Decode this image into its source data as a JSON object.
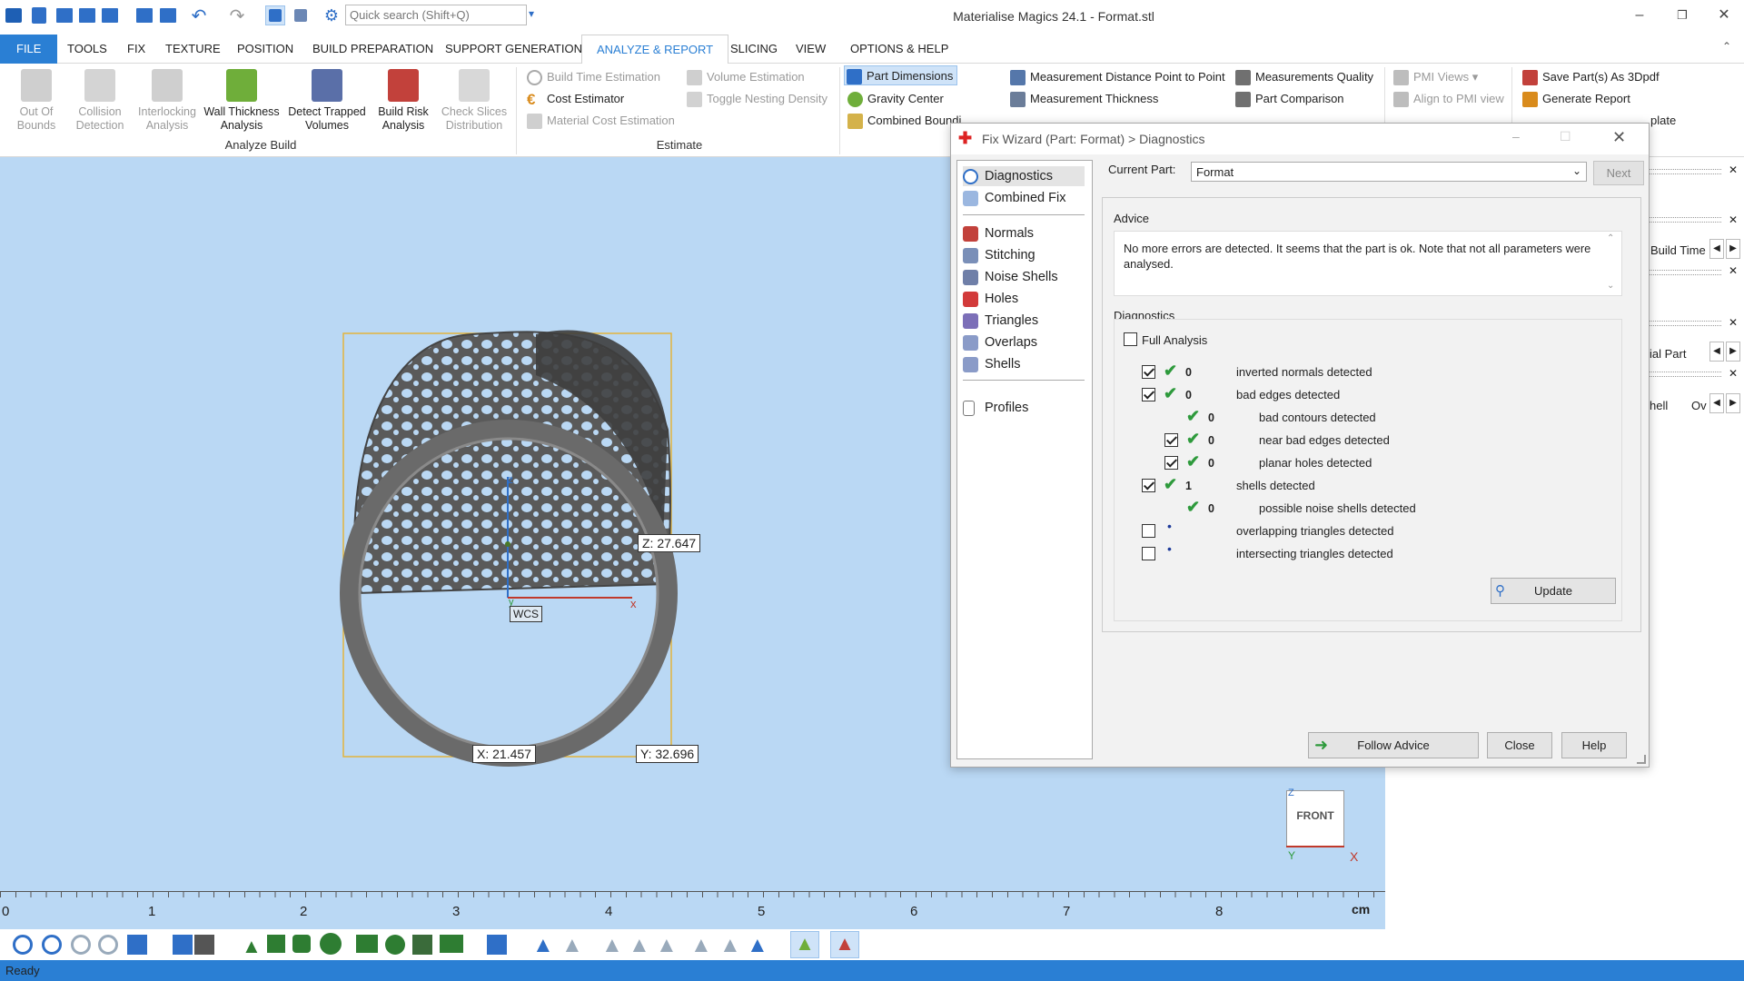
{
  "app": {
    "title": "Materialise Magics 24.1 - Format.stl",
    "search_placeholder": "Quick search (Shift+Q)"
  },
  "menu": [
    "FILE",
    "TOOLS",
    "FIX",
    "TEXTURE",
    "POSITION",
    "BUILD PREPARATION",
    "SUPPORT GENERATION",
    "ANALYZE & REPORT",
    "SLICING",
    "VIEW",
    "OPTIONS & HELP"
  ],
  "ribbon": {
    "analyze_build": {
      "group_label": "Analyze Build",
      "tools": [
        "Out Of Bounds",
        "Collision Detection",
        "Interlocking Analysis",
        "Wall Thickness Analysis",
        "Detect Trapped Volumes",
        "Build Risk Analysis",
        "Check Slices Distribution"
      ]
    },
    "estimate": {
      "group_label": "Estimate",
      "tools": [
        "Build Time Estimation",
        "Cost Estimator",
        "Material Cost Estimation",
        "Volume Estimation",
        "Toggle Nesting Density"
      ]
    },
    "measure": {
      "tools": [
        "Part Dimensions",
        "Gravity Center",
        "Combined Boundi",
        "Measurement Distance Point to Point",
        "Measurement Thickness",
        "Measurements Quality",
        "Part Comparison"
      ]
    },
    "pmi": {
      "tools": [
        "PMI Views",
        "Align to PMI view"
      ]
    },
    "report": {
      "tools": [
        "Save Part(s) As 3Dpdf",
        "Generate Report",
        "plate"
      ]
    }
  },
  "viewport": {
    "dim_z": "Z: 27.647",
    "dim_x": "X: 21.457",
    "dim_y": "Y: 32.696",
    "wcs": "WCS",
    "axis_z": "z",
    "axis_x": "x",
    "axis_y": "y",
    "view_cube": "FRONT",
    "cube_z": "Z",
    "cube_x": "X",
    "cube_y": "Y"
  },
  "ruler": {
    "ticks": [
      "0",
      "1",
      "2",
      "3",
      "4",
      "5",
      "6",
      "7",
      "8"
    ],
    "unit": "cm"
  },
  "status": "Ready",
  "right_panel": {
    "build_time": "Build Time",
    "ial_part": "ial Part",
    "hell": "hell",
    "ov": "Ov"
  },
  "dialog": {
    "title": "Fix Wizard (Part: Format) > Diagnostics",
    "nav": [
      "Diagnostics",
      "Combined Fix",
      "Normals",
      "Stitching",
      "Noise Shells",
      "Holes",
      "Triangles",
      "Overlaps",
      "Shells",
      "Profiles"
    ],
    "current_part_label": "Current Part:",
    "current_part_value": "Format",
    "next_label": "Next",
    "advice_label": "Advice",
    "advice_text": "No more errors are detected. It seems that the part is ok. Note that not all parameters were analysed.",
    "diagnostics_label": "Diagnostics",
    "full_analysis": "Full Analysis",
    "rows": [
      {
        "count": "0",
        "label": "inverted normals detected"
      },
      {
        "count": "0",
        "label": "bad edges detected"
      },
      {
        "count": "0",
        "label": "bad contours detected"
      },
      {
        "count": "0",
        "label": "near bad edges detected"
      },
      {
        "count": "0",
        "label": "planar holes detected"
      },
      {
        "count": "1",
        "label": "shells detected"
      },
      {
        "count": "0",
        "label": "possible noise shells detected"
      },
      {
        "count": "",
        "label": "overlapping triangles detected"
      },
      {
        "count": "",
        "label": "intersecting triangles detected"
      }
    ],
    "update_label": "Update",
    "follow_advice_label": "Follow Advice",
    "close_label": "Close",
    "help_label": "Help"
  },
  "colors": {
    "accent": "#2a7fd4",
    "viewport_bg": "#bad8f4",
    "check_green": "#2e9a3c"
  }
}
